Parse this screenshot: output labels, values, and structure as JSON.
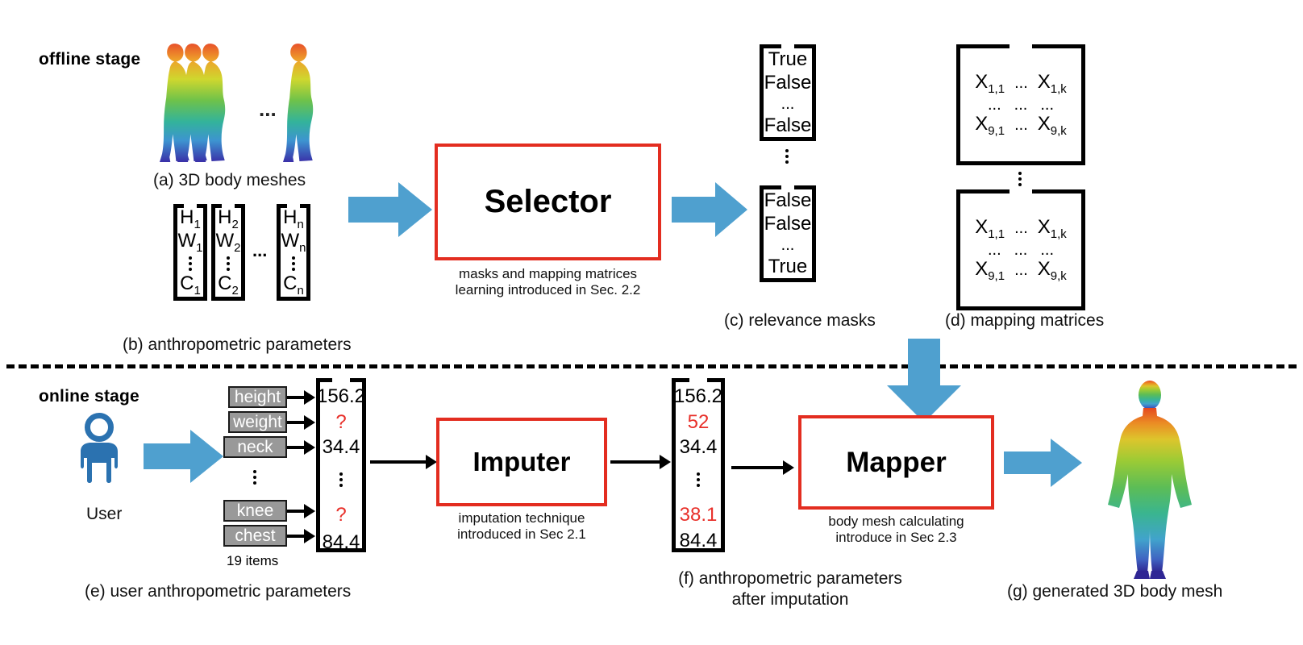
{
  "figure": {
    "stages": {
      "offline": "offline stage",
      "online": "online stage"
    },
    "divider": "dashed-horizontal-divider"
  },
  "offline": {
    "meshes": {
      "caption": "(a) 3D body meshes",
      "ellipsis": "...",
      "count_shown": 4
    },
    "params": {
      "caption": "(b) anthropometric parameters",
      "ellipsis": "...",
      "vectors": [
        {
          "rows": [
            "H",
            "W",
            "C"
          ],
          "subscript": "1"
        },
        {
          "rows": [
            "H",
            "W",
            "C"
          ],
          "subscript": "2"
        },
        {
          "rows": [
            "H",
            "W",
            "C"
          ],
          "subscript": "n"
        }
      ],
      "labels": {
        "h1": "H",
        "h1s": "1",
        "w1": "W",
        "w1s": "1",
        "c1": "C",
        "c1s": "1",
        "h2": "H",
        "h2s": "2",
        "w2": "W",
        "w2s": "2",
        "c2": "C",
        "c2s": "2",
        "hn": "H",
        "hns": "n",
        "wn": "W",
        "wns": "n",
        "cn": "C",
        "cns": "n"
      }
    },
    "selector": {
      "title": "Selector",
      "sub_line1": "masks and mapping matrices",
      "sub_line2": "learning introduced in Sec. 2.2"
    },
    "masks": {
      "caption": "(c) relevance masks",
      "top_vector": [
        "True",
        "False",
        "...",
        "False"
      ],
      "bottom_vector": [
        "False",
        "False",
        "...",
        "True"
      ]
    },
    "matrices": {
      "caption": "(d) mapping matrices",
      "top_matrix_rows": [
        [
          "X",
          "1,1",
          "...",
          "X",
          "1,k"
        ],
        [
          "...",
          "...",
          "..."
        ],
        [
          "X",
          "9,1",
          "...",
          "X",
          "9,k"
        ]
      ],
      "cells": {
        "r1c1": "X",
        "r1c1s": "1,1",
        "r1mid": "...",
        "r1c3": "X",
        "r1c3s": "1,k",
        "r2c1": "...",
        "r2mid": "...",
        "r2c3": "...",
        "r3c1": "X",
        "r3c1s": "9,1",
        "r3mid": "...",
        "r3c3": "X",
        "r3c3s": "9,k"
      }
    }
  },
  "online": {
    "user": {
      "label": "User",
      "icon": "person-icon"
    },
    "user_params": {
      "caption_line1": "(e) user anthropometric parameters",
      "items_note": "19 items",
      "chips": [
        "height",
        "weight",
        "neck",
        "knee",
        "chest"
      ],
      "values": [
        "156.2",
        "?",
        "34.4",
        "?",
        "84.4"
      ],
      "value_missing_flags": [
        false,
        true,
        false,
        true,
        false
      ]
    },
    "imputer": {
      "title": "Imputer",
      "sub_line1": "imputation technique",
      "sub_line2": "introduced in Sec 2.1"
    },
    "imputed": {
      "caption_line1": "(f) anthropometric parameters",
      "caption_line2": "after imputation",
      "values": [
        "156.2",
        "52",
        "34.4",
        "38.1",
        "84.4"
      ],
      "imputed_flags": [
        false,
        true,
        false,
        true,
        false
      ]
    },
    "mapper": {
      "title": "Mapper",
      "sub_line1": "body mesh calculating",
      "sub_line2": "introduce in Sec 2.3"
    },
    "output": {
      "caption": "(g) generated 3D body mesh"
    }
  },
  "colors": {
    "accent_blue": "#4FA0CF",
    "box_red": "#E32D20",
    "missing_red": "#E8302A",
    "chip_gray": "#999999",
    "text_black": "#000000"
  }
}
